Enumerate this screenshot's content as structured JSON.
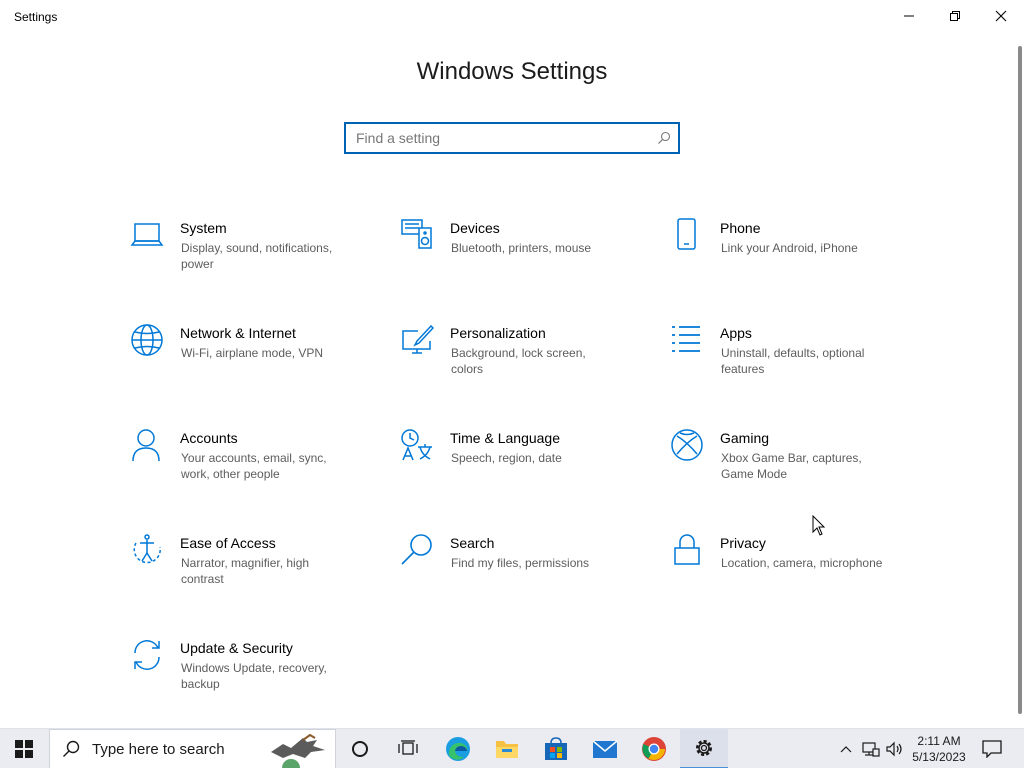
{
  "window": {
    "title": "Settings",
    "controls": {
      "minimize": "minimize",
      "maximize": "restore",
      "close": "close"
    }
  },
  "main": {
    "heading": "Windows Settings",
    "search": {
      "placeholder": "Find a setting",
      "value": ""
    },
    "categories": [
      {
        "name": "System",
        "desc": "Display, sound, notifications, power",
        "icon": "laptop-icon"
      },
      {
        "name": "Devices",
        "desc": "Bluetooth, printers, mouse",
        "icon": "devices-icon"
      },
      {
        "name": "Phone",
        "desc": "Link your Android, iPhone",
        "icon": "phone-icon"
      },
      {
        "name": "Network & Internet",
        "desc": "Wi-Fi, airplane mode, VPN",
        "icon": "globe-icon"
      },
      {
        "name": "Personalization",
        "desc": "Background, lock screen, colors",
        "icon": "personalization-icon"
      },
      {
        "name": "Apps",
        "desc": "Uninstall, defaults, optional features",
        "icon": "apps-list-icon"
      },
      {
        "name": "Accounts",
        "desc": "Your accounts, email, sync, work, other people",
        "icon": "person-icon"
      },
      {
        "name": "Time & Language",
        "desc": "Speech, region, date",
        "icon": "time-language-icon"
      },
      {
        "name": "Gaming",
        "desc": "Xbox Game Bar, captures, Game Mode",
        "icon": "xbox-icon"
      },
      {
        "name": "Ease of Access",
        "desc": "Narrator, magnifier, high contrast",
        "icon": "ease-of-access-icon"
      },
      {
        "name": "Search",
        "desc": "Find my files, permissions",
        "icon": "magnifier-icon"
      },
      {
        "name": "Privacy",
        "desc": "Location, camera, microphone",
        "icon": "lock-icon"
      },
      {
        "name": "Update & Security",
        "desc": "Windows Update, recovery, backup",
        "icon": "sync-arrows-icon"
      }
    ]
  },
  "taskbar": {
    "search_label": "Type here to search",
    "apps": [
      "cortana-icon",
      "task-view-icon",
      "edge-icon",
      "file-explorer-icon",
      "store-icon",
      "mail-icon",
      "chrome-icon",
      "settings-gear-icon"
    ],
    "tray": [
      "chevron-up-icon",
      "network-icon",
      "volume-icon"
    ],
    "time": "2:11 AM",
    "date": "5/13/2023"
  },
  "colors": {
    "accent": "#0063b1",
    "icon_blue": "#0078d7"
  }
}
